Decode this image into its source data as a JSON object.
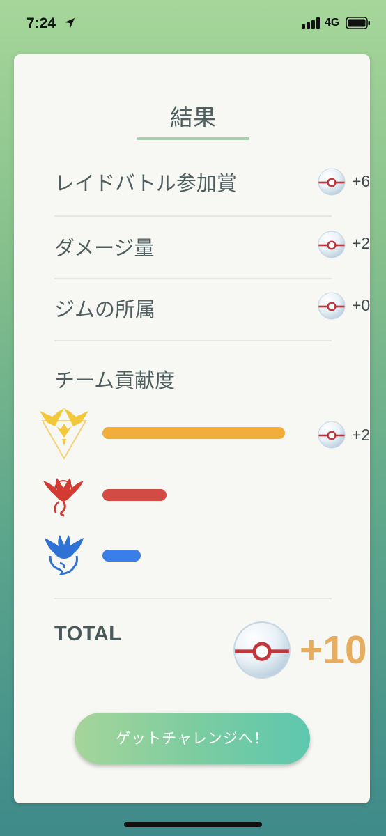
{
  "status_bar": {
    "time": "7:24",
    "network": "4G"
  },
  "results": {
    "title": "結果",
    "rows": [
      {
        "label": "レイドバトル参加賞",
        "value": "+6"
      },
      {
        "label": "ダメージ量",
        "value": "+2"
      },
      {
        "label": "ジムの所属",
        "value": "+0"
      }
    ],
    "team_contribution": {
      "label": "チーム貢献度",
      "teams": [
        {
          "name": "instinct",
          "color": "#f2ae3d",
          "bar_fraction": 1.0,
          "value": "+2"
        },
        {
          "name": "valor",
          "color": "#d24b45",
          "bar_fraction": 0.35
        },
        {
          "name": "mystic",
          "color": "#3a7fe9",
          "bar_fraction": 0.21
        }
      ]
    },
    "total": {
      "label": "TOTAL",
      "value": "+10"
    }
  },
  "cta": {
    "label": "ゲットチャレンジへ！"
  },
  "icons": {
    "reward": "premier-ball-icon",
    "teams": [
      "team-instinct-icon",
      "team-valor-icon",
      "team-mystic-icon"
    ]
  }
}
